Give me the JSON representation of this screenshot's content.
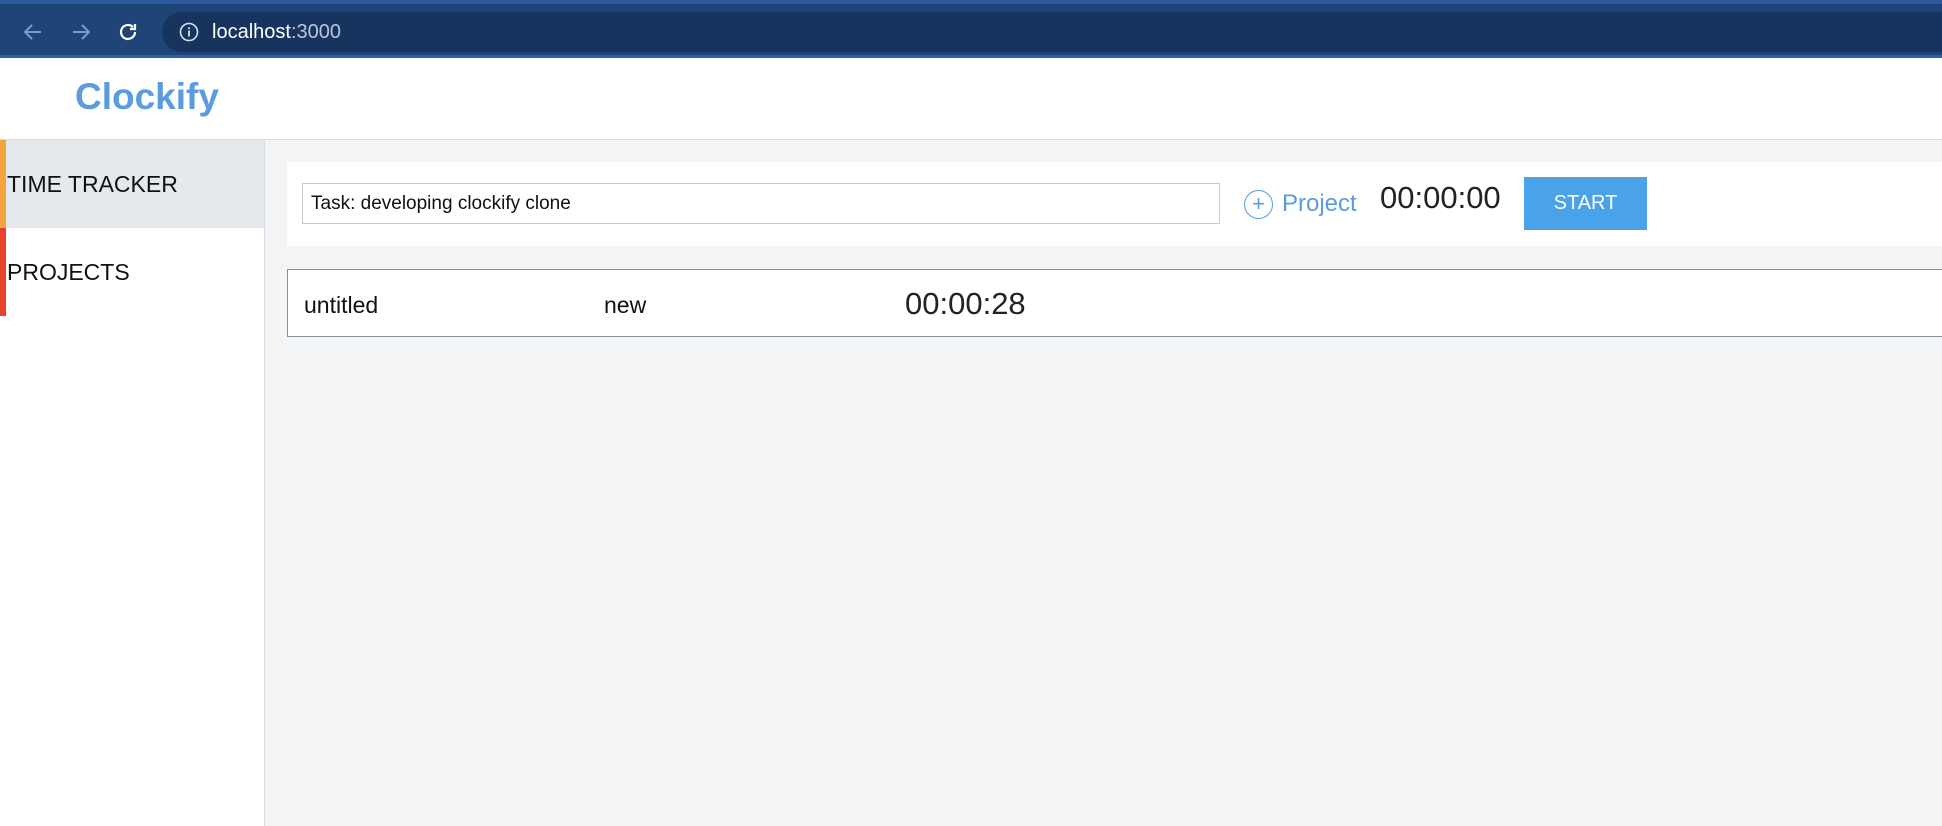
{
  "browser": {
    "url_host": "localhost",
    "url_port": ":3000",
    "icons": {
      "back": "arrow-left-icon",
      "forward": "arrow-right-icon",
      "reload": "reload-icon",
      "info": "info-icon"
    }
  },
  "app": {
    "logo": "Clockify",
    "brand_color": "#5b9be0"
  },
  "sidebar": {
    "items": [
      {
        "label": "TIME TRACKER",
        "active": true,
        "accent_color": "#f4a43c"
      },
      {
        "label": "PROJECTS",
        "active": false,
        "accent_color": "#e8412c"
      }
    ]
  },
  "tracker": {
    "task_value": "Task: developing clockify clone",
    "project_label": "Project",
    "project_icon": "plus-circle-icon",
    "timer": "00:00:00",
    "start_label": "START",
    "start_color": "#4aa3e8"
  },
  "entries": [
    {
      "name": "untitled",
      "project": "new",
      "duration": "00:00:28"
    }
  ]
}
